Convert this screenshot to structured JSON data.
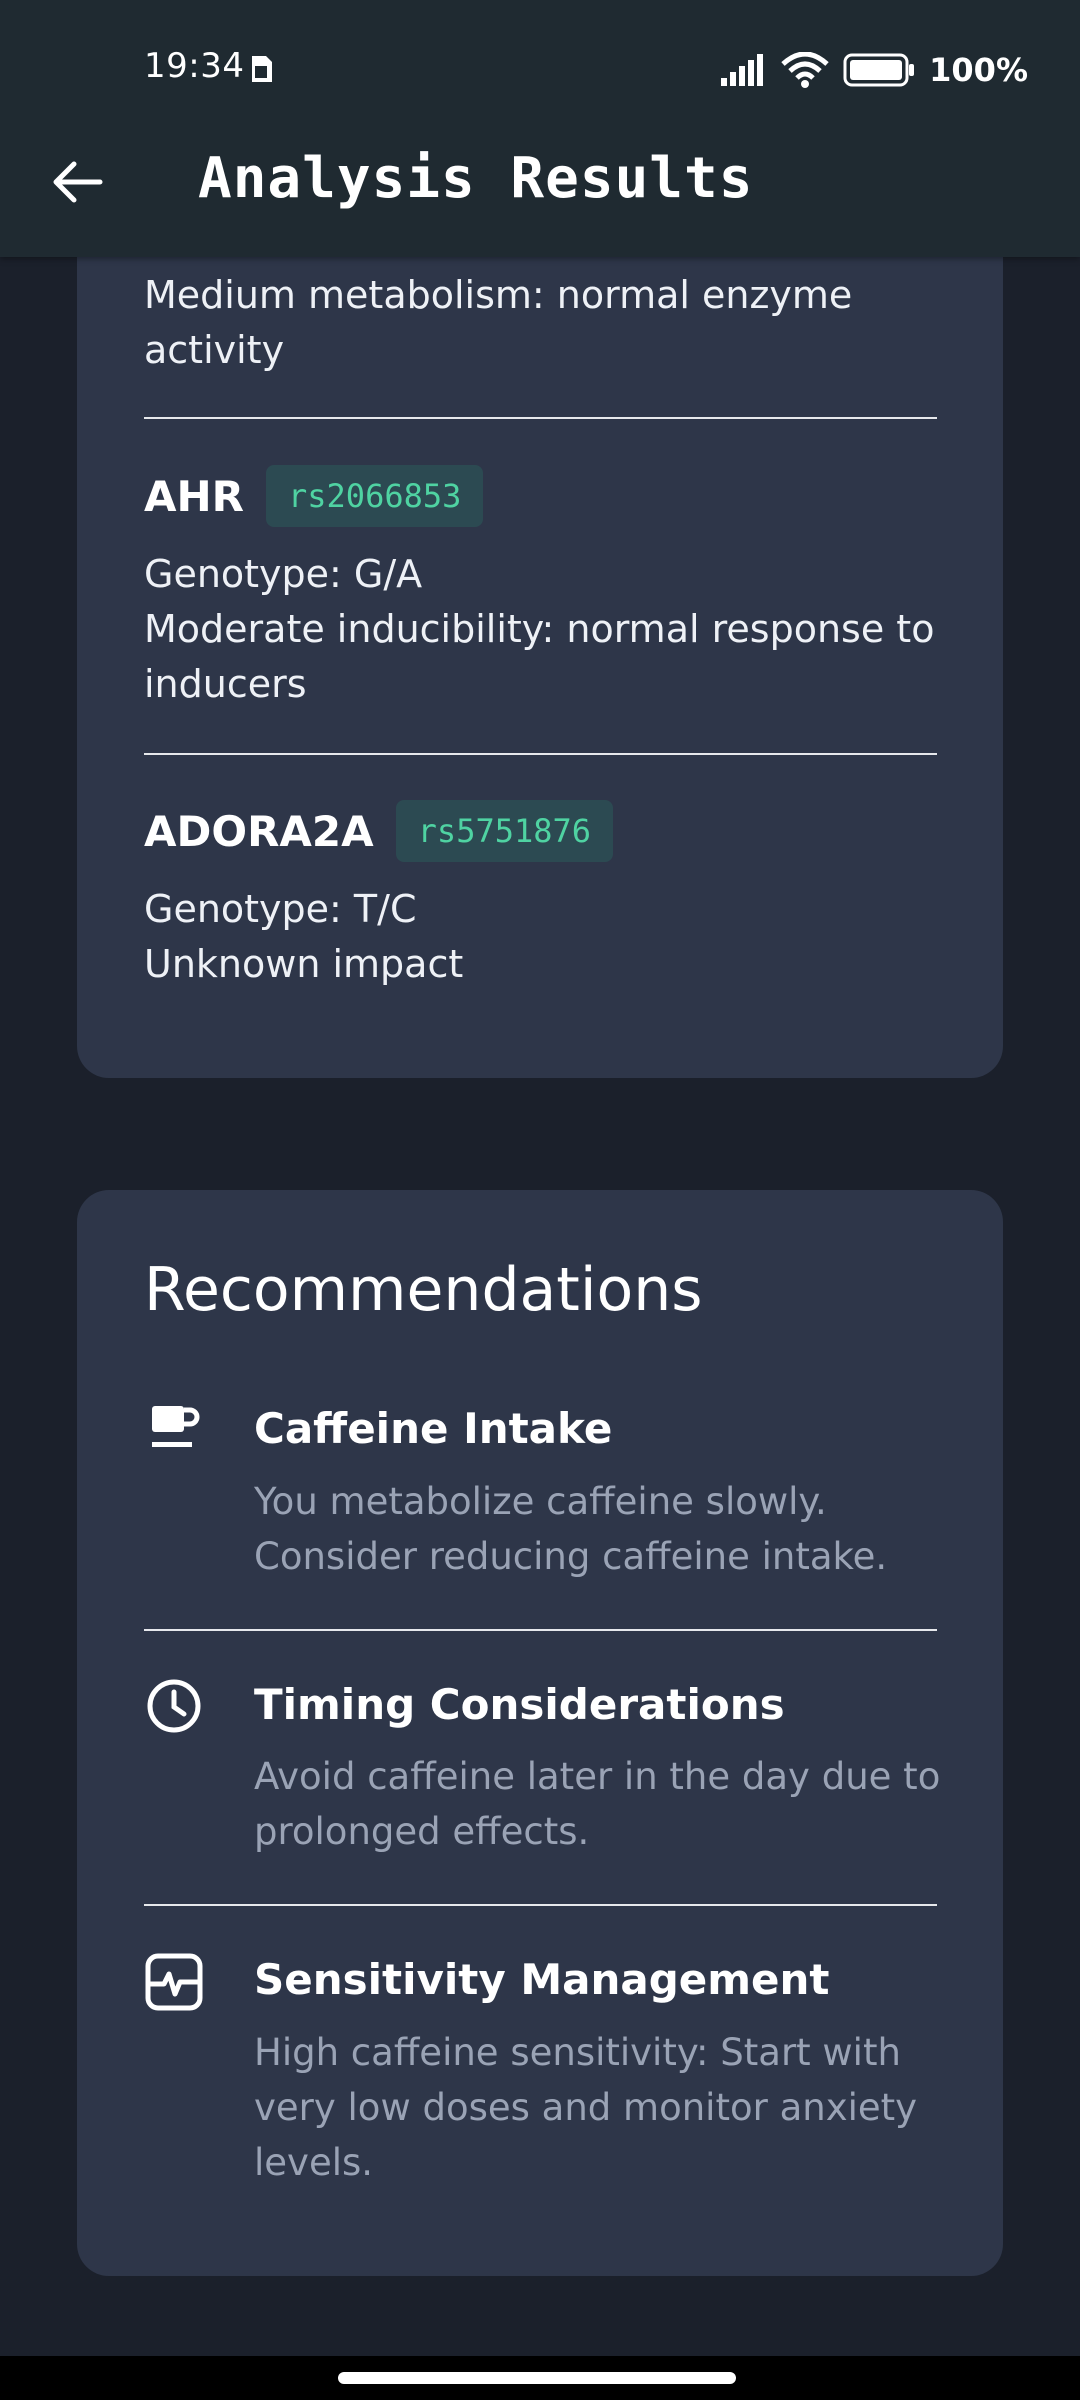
{
  "status_bar": {
    "time": "19:34",
    "battery": "100%"
  },
  "app_bar": {
    "title": "Analysis Results"
  },
  "genes": [
    {
      "partial_text": "Medium metabolism: normal enzyme activity"
    },
    {
      "name": "AHR",
      "rsid": "rs2066853",
      "genotype": "Genotype: G/A",
      "impact": "Moderate inducibility: normal response to inducers"
    },
    {
      "name": "ADORA2A",
      "rsid": "rs5751876",
      "genotype": "Genotype: T/C",
      "impact": "Unknown impact"
    }
  ],
  "recommendations": {
    "title": "Recommendations",
    "items": [
      {
        "icon": "coffee-cup-icon",
        "heading": "Caffeine Intake",
        "body": "You metabolize caffeine slowly. Consider reducing caffeine intake."
      },
      {
        "icon": "clock-icon",
        "heading": "Timing Considerations",
        "body": "Avoid caffeine later in the day due to prolonged effects."
      },
      {
        "icon": "heart-monitor-icon",
        "heading": "Sensitivity Management",
        "body": "High caffeine sensitivity: Start with very low doses and monitor anxiety levels."
      }
    ]
  },
  "colors": {
    "background": "#1b202b",
    "card": "#2e3649",
    "app_bar": "#1f2a31",
    "badge_bg": "#2c4a52",
    "badge_text": "#4fd3a2",
    "muted_text": "#9aa3b5"
  }
}
